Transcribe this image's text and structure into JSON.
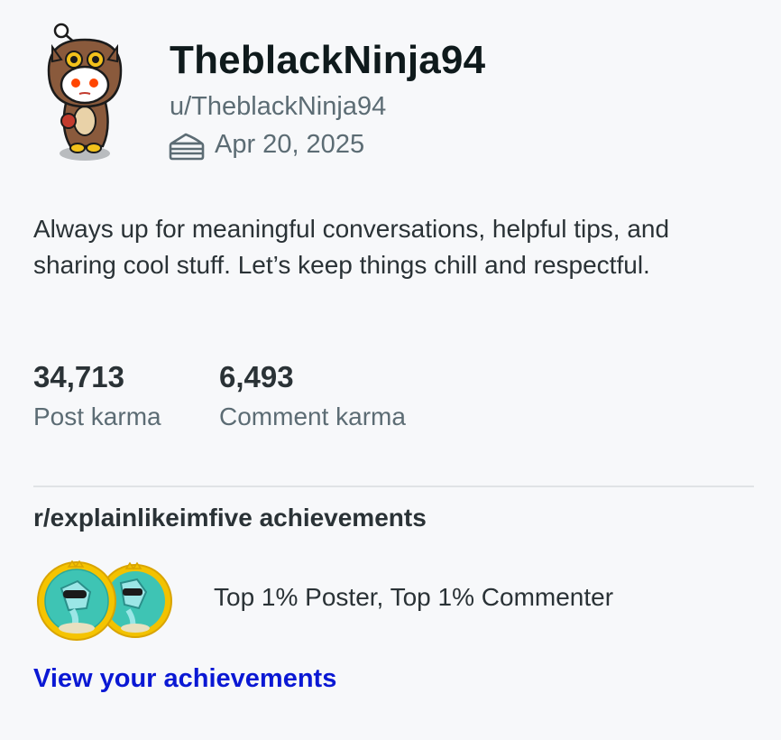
{
  "profile": {
    "display_name": "TheblackNinja94",
    "username": "u/TheblackNinja94",
    "cake_day": "Apr 20, 2025",
    "bio": "Always up for meaningful conversations, helpful tips, and sharing cool stuff. Let’s keep things chill and respectful."
  },
  "karma": {
    "post_value": "34,713",
    "post_label": "Post karma",
    "comment_value": "6,493",
    "comment_label": "Comment karma"
  },
  "achievements": {
    "title": "r/explainlikeimfive achievements",
    "badges": [
      "Top 1% Poster",
      "Top 1% Commenter"
    ],
    "summary": "Top 1% Poster, Top 1% Commenter",
    "link_label": "View your achievements"
  },
  "icons": {
    "cake": "cake-icon",
    "avatar": "snoo-owl-avatar",
    "badge": "top-contributor-badge-icon"
  },
  "colors": {
    "background": "#f7f8fa",
    "text_primary": "#0f1a1c",
    "text_secondary": "#5c6c74",
    "link": "#0a18d4",
    "badge_gold": "#f2c200",
    "badge_teal": "#3ec4b4"
  }
}
